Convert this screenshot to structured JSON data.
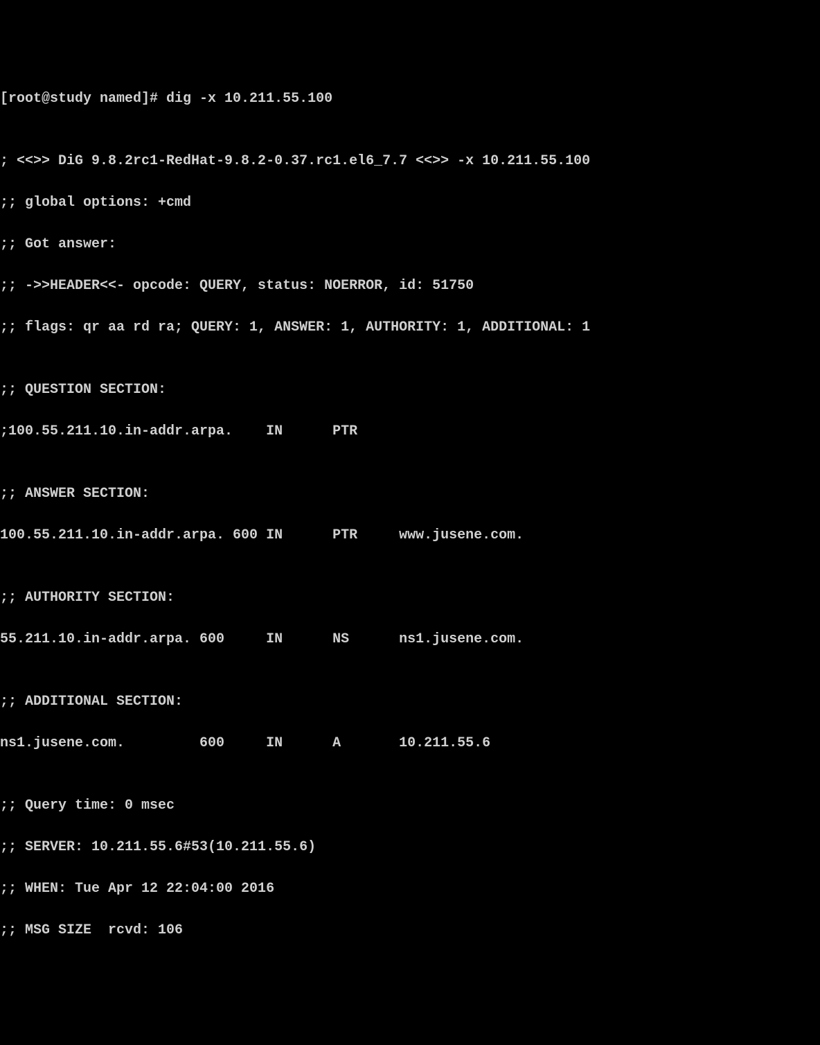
{
  "prompt": "[root@study named]# dig -x 10.211.55.100",
  "blank": "",
  "version": "; <<>> DiG 9.8.2rc1-RedHat-9.8.2-0.37.rc1.el6_7.7 <<>> -x 10.211.55.100",
  "global_options": ";; global options: +cmd",
  "got_answer": ";; Got answer:",
  "header": ";; ->>HEADER<<- opcode: QUERY, status: NOERROR, id: 51750",
  "flags": ";; flags: qr aa rd ra; QUERY: 1, ANSWER: 1, AUTHORITY: 1, ADDITIONAL: 1",
  "question_section_header": ";; QUESTION SECTION:",
  "question_line": ";100.55.211.10.in-addr.arpa.    IN      PTR",
  "answer_section_header": ";; ANSWER SECTION:",
  "answer_line": "100.55.211.10.in-addr.arpa. 600 IN      PTR     www.jusene.com.",
  "authority_section_header": ";; AUTHORITY SECTION:",
  "authority_line": "55.211.10.in-addr.arpa. 600     IN      NS      ns1.jusene.com.",
  "additional_section_header": ";; ADDITIONAL SECTION:",
  "additional_line": "ns1.jusene.com.         600     IN      A       10.211.55.6",
  "query_time": ";; Query time: 0 msec",
  "server": ";; SERVER: 10.211.55.6#53(10.211.55.6)",
  "when": ";; WHEN: Tue Apr 12 22:04:00 2016",
  "msg_size": ";; MSG SIZE  rcvd: 106"
}
